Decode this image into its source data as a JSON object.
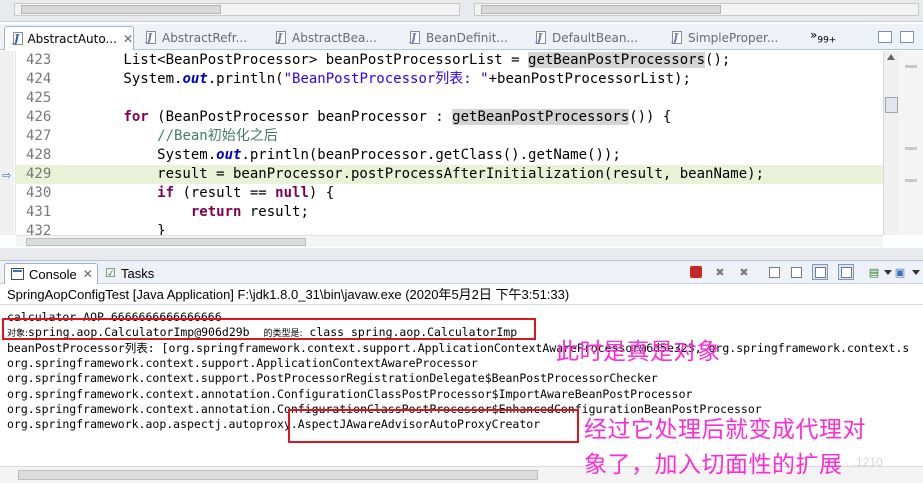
{
  "editor_tabs": [
    {
      "label": "AbstractAuto...",
      "active": true,
      "close": "✕"
    },
    {
      "label": "AbstractRefr..."
    },
    {
      "label": "AbstractBea..."
    },
    {
      "label": "BeanDefinit..."
    },
    {
      "label": "DefaultBean..."
    },
    {
      "label": "SimpleProper..."
    }
  ],
  "tab_overflow": {
    "chevron": "»",
    "count": "99+"
  },
  "code_lines": [
    {
      "num": "423",
      "segments": [
        {
          "t": "        List<BeanPostProcessor> beanPostProcessorList = "
        },
        {
          "t": "getBeanPostProcessors",
          "c": "hl"
        },
        {
          "t": "();"
        }
      ]
    },
    {
      "num": "424",
      "segments": [
        {
          "t": "        System."
        },
        {
          "t": "out",
          "c": "fld"
        },
        {
          "t": ".println("
        },
        {
          "t": "\"BeanPostProcessor列表: \"",
          "c": "str"
        },
        {
          "t": "+beanPostProcessorList);"
        }
      ]
    },
    {
      "num": "425",
      "segments": []
    },
    {
      "num": "426",
      "segments": [
        {
          "t": "        "
        },
        {
          "t": "for",
          "c": "kw"
        },
        {
          "t": " (BeanPostProcessor beanProcessor : "
        },
        {
          "t": "getBeanPostProcessors",
          "c": "hl"
        },
        {
          "t": "()) {"
        }
      ]
    },
    {
      "num": "427",
      "segments": [
        {
          "t": "            "
        },
        {
          "t": "//Bean初始化之后",
          "c": "cmt"
        }
      ]
    },
    {
      "num": "428",
      "segments": [
        {
          "t": "            System."
        },
        {
          "t": "out",
          "c": "fld"
        },
        {
          "t": ".println(beanProcessor.getClass().getName());"
        }
      ]
    },
    {
      "num": "429",
      "current": true,
      "segments": [
        {
          "t": "            result = beanProcessor.postProcessAfterInitialization(result, beanName);"
        }
      ]
    },
    {
      "num": "430",
      "segments": [
        {
          "t": "            "
        },
        {
          "t": "if",
          "c": "kw"
        },
        {
          "t": " (result == "
        },
        {
          "t": "null",
          "c": "kw"
        },
        {
          "t": ") {"
        }
      ]
    },
    {
      "num": "431",
      "segments": [
        {
          "t": "                "
        },
        {
          "t": "return",
          "c": "kw"
        },
        {
          "t": " result;"
        }
      ]
    },
    {
      "num": "432",
      "segments": [
        {
          "t": "            }"
        }
      ]
    }
  ],
  "console_tabs": [
    {
      "label": "Console",
      "active": true,
      "close": "✕"
    },
    {
      "label": "Tasks"
    }
  ],
  "console_header": "SpringAopConfigTest [Java Application] F:\\jdk1.8.0_31\\bin\\javaw.exe (2020年5月2日 下午3:51:33)",
  "console_lines": [
    {
      "parts": [
        {
          "t": "calculator AOP 6666666666666666"
        }
      ]
    },
    {
      "parts": [
        {
          "t": "对象:",
          "cn": true
        },
        {
          "t": "spring.aop.CalculatorImp@906d29b  "
        },
        {
          "t": "的类型是:",
          "cn": true
        },
        {
          "t": " class spring.aop.CalculatorImp"
        }
      ]
    },
    {
      "parts": [
        {
          "t": "beanPostProcessor列表: [org.springframework.context.support.ApplicationContextAwareProcessor@6d5e323, org.springframework.context.s"
        }
      ]
    },
    {
      "parts": [
        {
          "t": "org.springframework.context.support.ApplicationContextAwareProcessor"
        }
      ]
    },
    {
      "parts": [
        {
          "t": "org.springframework.context.support.PostProcessorRegistrationDelegate$BeanPostProcessorChecker"
        }
      ]
    },
    {
      "parts": [
        {
          "t": "org.springframework.context.annotation.ConfigurationClassPostProcessor$ImportAwareBeanPostProcessor"
        }
      ]
    },
    {
      "parts": [
        {
          "t": "org.springframework.context.annotation.ConfigurationClassPostProcessor$EnhancedConfigurationBeanPostProcessor"
        }
      ]
    },
    {
      "parts": [
        {
          "t": "org.springframework.aop.aspectj.autoproxy.AspectJAwareAdvisorAutoProxyCreator"
        }
      ]
    }
  ],
  "annotations": {
    "real_object": "此时是真是对象",
    "proxy_line1": "经过它处理后就变成代理对",
    "proxy_line2": "象了，加入切面性的扩展"
  },
  "watermark": "...1210",
  "colors": {
    "annotation_text": "#ff2bd4",
    "annotation_box": "#e0141e",
    "current_line_bg": "#e8f2d6",
    "keyword": "#7f0055",
    "string": "#2a00ff",
    "comment": "#3f7f5f"
  }
}
